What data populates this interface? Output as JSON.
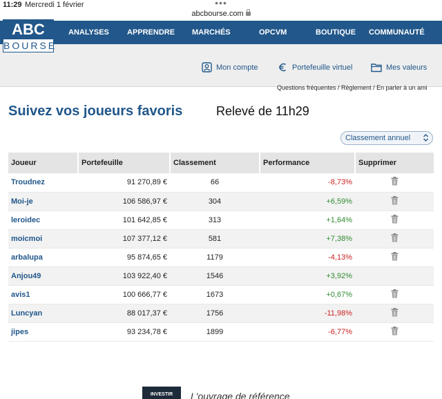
{
  "status": {
    "time": "11:29",
    "date": "Mercredi 1 février",
    "url": "abcbourse.com"
  },
  "logo": {
    "top": "ABC",
    "bottom": "BOURSE"
  },
  "nav": [
    {
      "label": "ANALYSES"
    },
    {
      "label": "APPRENDRE"
    },
    {
      "label": "MARCHÉS"
    },
    {
      "label": "OPCVM"
    },
    {
      "label": "BOUTIQUE"
    },
    {
      "label": "COMMUNAUTÉ"
    }
  ],
  "subnav": {
    "account": "Mon compte",
    "portfolio": "Portefeuille virtuel",
    "values": "Mes valeurs"
  },
  "help_links": "Questions fréquentes / Règlement / En parler à un ami",
  "page_title": "Suivez vos joueurs favoris",
  "releve": "Relevé de 11h29",
  "ranking_select": {
    "selected": "Classement annuel"
  },
  "table": {
    "headers": [
      "Joueur",
      "Portefeuille",
      "Classement",
      "Performance",
      "Supprimer"
    ],
    "rows": [
      {
        "player": "Troudnez",
        "portfolio": "91 270,89 €",
        "rank": "66",
        "perf": "-8,73%",
        "trend": "neg",
        "deletable": true
      },
      {
        "player": "Moi-je",
        "portfolio": "106 586,97 €",
        "rank": "304",
        "perf": "+6,59%",
        "trend": "pos",
        "deletable": true
      },
      {
        "player": "leroidec",
        "portfolio": "101 642,85 €",
        "rank": "313",
        "perf": "+1,64%",
        "trend": "pos",
        "deletable": true
      },
      {
        "player": "moicmoi",
        "portfolio": "107 377,12 €",
        "rank": "581",
        "perf": "+7,38%",
        "trend": "pos",
        "deletable": true
      },
      {
        "player": "arbalupa",
        "portfolio": "95 874,65 €",
        "rank": "1179",
        "perf": "-4,13%",
        "trend": "neg",
        "deletable": true
      },
      {
        "player": "Anjou49",
        "portfolio": "103 922,40 €",
        "rank": "1546",
        "perf": "+3,92%",
        "trend": "pos",
        "deletable": false
      },
      {
        "player": "avis1",
        "portfolio": "100 666,77 €",
        "rank": "1673",
        "perf": "+0,67%",
        "trend": "pos",
        "deletable": true
      },
      {
        "player": "Luncyan",
        "portfolio": "88 017,37 €",
        "rank": "1756",
        "perf": "-11,98%",
        "trend": "neg",
        "deletable": true
      },
      {
        "player": "jipes",
        "portfolio": "93 234,78 €",
        "rank": "1899",
        "perf": "-6,77%",
        "trend": "neg",
        "deletable": true
      }
    ]
  },
  "promo": {
    "book_label": "INVESTIR",
    "text": "L'ouvrage de référence"
  },
  "colors": {
    "brand": "#21578a",
    "negative": "#cc2222",
    "positive": "#2f8a2f"
  },
  "icons": {
    "account": "user-square-icon",
    "portfolio": "euro-circle-icon",
    "values": "folder-icon",
    "delete": "trash-icon",
    "select": "chevron-updown-icon",
    "lock": "lock-icon"
  }
}
